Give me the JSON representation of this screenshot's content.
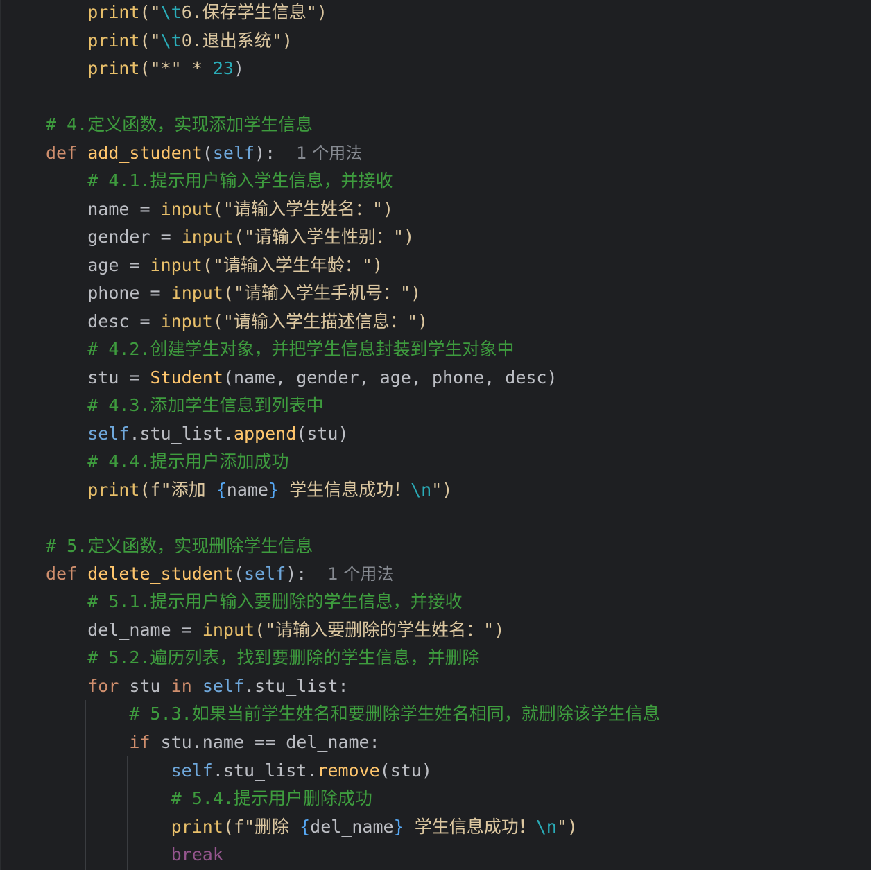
{
  "lines": {
    "l1": {
      "indent": "    ",
      "fn": "print",
      "open": "(\"",
      "esc": "\\t",
      "text": "6.保存学生信息",
      "close": "\")"
    },
    "l2": {
      "indent": "    ",
      "fn": "print",
      "open": "(\"",
      "esc": "\\t",
      "text": "0.退出系统",
      "close": "\")"
    },
    "l3": {
      "indent": "    ",
      "fn": "print",
      "open": "(\"*\" * ",
      "num": "23",
      "close": ")"
    },
    "c4": "# 4.定义函数，实现添加学生信息",
    "d4": {
      "kw": "def",
      "name": "add_student",
      "open": "(",
      "self": "self",
      "close": "):",
      "usage": "1 个用法"
    },
    "c41": "# 4.1.提示用户输入学生信息，并接收",
    "i1": {
      "var": "name = ",
      "fn": "input",
      "str": "(\"请输入学生姓名：\")"
    },
    "i2": {
      "var": "gender = ",
      "fn": "input",
      "str": "(\"请输入学生性别：\")"
    },
    "i3": {
      "var": "age = ",
      "fn": "input",
      "str": "(\"请输入学生年龄：\")"
    },
    "i4": {
      "var": "phone = ",
      "fn": "input",
      "str": "(\"请输入学生手机号：\")"
    },
    "i5": {
      "var": "desc = ",
      "fn": "input",
      "str": "(\"请输入学生描述信息：\")"
    },
    "c42": "# 4.2.创建学生对象，并把学生信息封装到学生对象中",
    "s1": {
      "var": "stu = ",
      "cls": "Student",
      "args": "(name, gender, age, phone, desc)"
    },
    "c43": "# 4.3.添加学生信息到列表中",
    "a1": {
      "self": "self",
      "mid": ".stu_list.",
      "fn": "append",
      "args": "(stu)"
    },
    "c44": "# 4.4.提示用户添加成功",
    "p1": {
      "fn": "print",
      "pre": "(f\"添加 ",
      "brace_open": "{",
      "var": "name",
      "brace_close": "}",
      "post": " 学生信息成功！",
      "esc": "\\n",
      "close": "\")"
    },
    "c5": "# 5.定义函数，实现删除学生信息",
    "d5": {
      "kw": "def",
      "name": "delete_student",
      "open": "(",
      "self": "self",
      "close": "):",
      "usage": "1 个用法"
    },
    "c51": "# 5.1.提示用户输入要删除的学生信息，并接收",
    "i6": {
      "var": "del_name = ",
      "fn": "input",
      "str": "(\"请输入要删除的学生姓名：\")"
    },
    "c52": "# 5.2.遍历列表，找到要删除的学生信息，并删除",
    "f1": {
      "kw1": "for",
      "mid1": " stu ",
      "kw2": "in",
      "sp": " ",
      "self": "self",
      "rest": ".stu_list:"
    },
    "c53": "# 5.3.如果当前学生姓名和要删除学生姓名相同，就删除该学生信息",
    "if1": {
      "kw": "if",
      "rest": " stu.name == del_name:"
    },
    "r1": {
      "self": "self",
      "mid": ".stu_list.",
      "fn": "remove",
      "args": "(stu)"
    },
    "c54": "# 5.4.提示用户删除成功",
    "p2": {
      "fn": "print",
      "pre": "(f\"删除 ",
      "brace_open": "{",
      "var": "del_name",
      "brace_close": "}",
      "post": " 学生信息成功！",
      "esc": "\\n",
      "close": "\")"
    },
    "b1": "break"
  }
}
